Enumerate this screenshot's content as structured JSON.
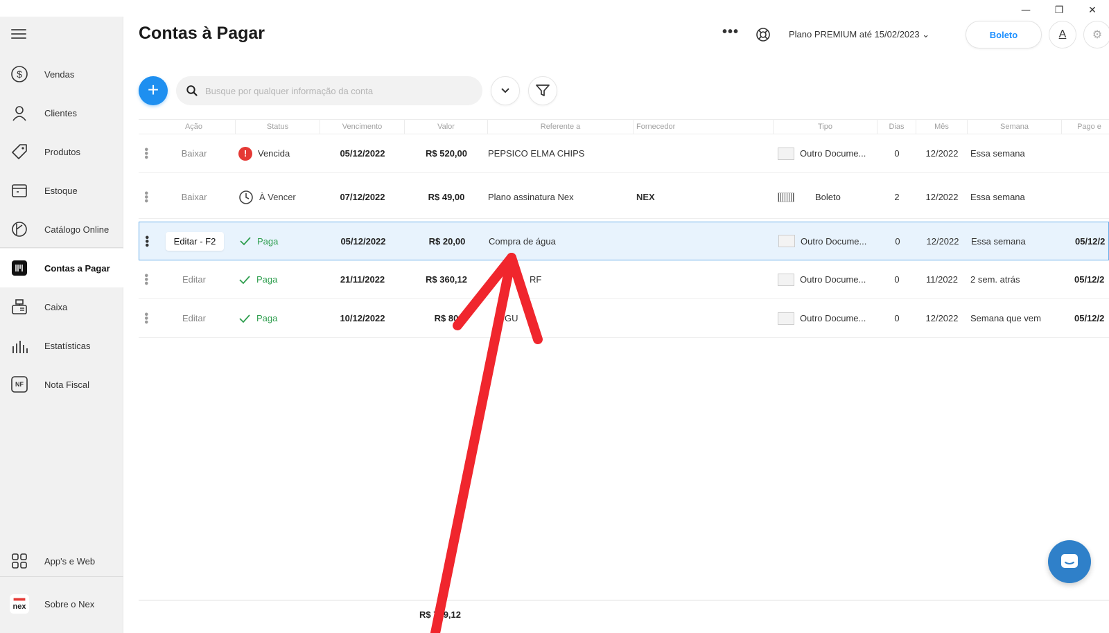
{
  "window": {
    "minimize": "—",
    "restore": "❐",
    "close": "✕"
  },
  "sidebar": {
    "items": [
      {
        "label": "Vendas",
        "icon": "dollar-circle-icon"
      },
      {
        "label": "Clientes",
        "icon": "person-icon"
      },
      {
        "label": "Produtos",
        "icon": "tag-icon"
      },
      {
        "label": "Estoque",
        "icon": "box-icon"
      },
      {
        "label": "Catálogo Online",
        "icon": "catalog-icon"
      },
      {
        "label": "Contas a Pagar",
        "icon": "bills-icon",
        "active": true
      },
      {
        "label": "Caixa",
        "icon": "cash-register-icon"
      },
      {
        "label": "Estatísticas",
        "icon": "bar-chart-icon"
      },
      {
        "label": "Nota Fiscal",
        "icon": "nf-icon",
        "badge": "NF"
      }
    ],
    "bottom": [
      {
        "label": "App's e Web",
        "icon": "grid-icon"
      },
      {
        "label": "Sobre o Nex",
        "icon": "nex-logo-icon",
        "logo_text": "nex"
      }
    ]
  },
  "header": {
    "title": "Contas à Pagar",
    "more": "•••",
    "plan": "Plano PREMIUM até 15/02/2023",
    "boleto_label": "Boleto",
    "font_label": "A"
  },
  "toolbar": {
    "add": "+",
    "search_placeholder": "Busque por qualquer informação da conta"
  },
  "table": {
    "columns": [
      "Ação",
      "Status",
      "Vencimento",
      "Valor",
      "Referente a",
      "Fornecedor",
      "Tipo",
      "Dias",
      "Mês",
      "Semana",
      "Pago e"
    ],
    "rows": [
      {
        "acao": "Baixar",
        "status": "Vencida",
        "status_kind": "vencida",
        "vencimento": "05/12/2022",
        "valor": "R$ 520,00",
        "referente": "PEPSICO ELMA CHIPS",
        "fornecedor": "",
        "tipo": "Outro Docume...",
        "tipo_kind": "doc",
        "dias": "0",
        "mes": "12/2022",
        "semana": "Essa semana",
        "pago": ""
      },
      {
        "acao": "Baixar",
        "status": "À Vencer",
        "status_kind": "avencer",
        "vencimento": "07/12/2022",
        "valor": "R$ 49,00",
        "referente": "Plano assinatura Nex",
        "fornecedor": "NEX",
        "tipo": "Boleto",
        "tipo_kind": "barcode",
        "dias": "2",
        "mes": "12/2022",
        "semana": "Essa semana",
        "pago": ""
      },
      {
        "acao": "Editar - F2",
        "status": "Paga",
        "status_kind": "paga",
        "vencimento": "05/12/2022",
        "valor": "R$ 20,00",
        "referente": "Compra de água",
        "fornecedor": "",
        "tipo": "Outro Docume...",
        "tipo_kind": "doc",
        "dias": "0",
        "mes": "12/2022",
        "semana": "Essa semana",
        "pago": "05/12/2",
        "selected": true
      },
      {
        "acao": "Editar",
        "status": "Paga",
        "status_kind": "paga",
        "vencimento": "21/11/2022",
        "valor": "R$ 360,12",
        "referente": "RF",
        "fornecedor": "",
        "tipo": "Outro Docume...",
        "tipo_kind": "doc",
        "dias": "0",
        "mes": "11/2022",
        "semana": "2 sem. atrás",
        "pago": "05/12/2"
      },
      {
        "acao": "Editar",
        "status": "Paga",
        "status_kind": "paga",
        "vencimento": "10/12/2022",
        "valor": "R$ 80",
        "referente": "GU",
        "fornecedor": "",
        "tipo": "Outro Docume...",
        "tipo_kind": "doc",
        "dias": "0",
        "mes": "12/2022",
        "semana": "Semana que vem",
        "pago": "05/12/2"
      }
    ]
  },
  "footer": {
    "total": "R$ 749,12"
  },
  "colors": {
    "accent": "#1e8ff0",
    "danger": "#e53935",
    "success": "#2e9e4e",
    "annotation": "#f0262d",
    "chat": "#2f80c9"
  }
}
